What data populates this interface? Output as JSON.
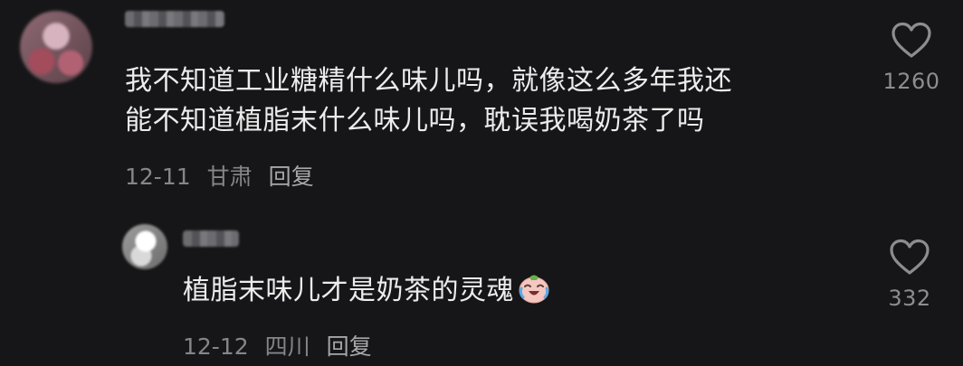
{
  "comments": [
    {
      "text_lines": [
        "我不知道工业糖精什么味儿吗，就像这么多年我还",
        "能不知道植脂末什么味儿吗，耽误我喝奶茶了吗"
      ],
      "date": "12-11",
      "location": "甘肃",
      "reply_label": "回复",
      "likes": "1260"
    }
  ],
  "replies": [
    {
      "text": "植脂末味儿才是奶茶的灵魂",
      "emoji": "crying-laughing-face-icon",
      "date": "12-12",
      "location": "四川",
      "reply_label": "回复",
      "likes": "332"
    }
  ],
  "colors": {
    "background": "#161618",
    "text": "#ececec",
    "meta": "#85858a",
    "icon": "#8d8d91"
  }
}
